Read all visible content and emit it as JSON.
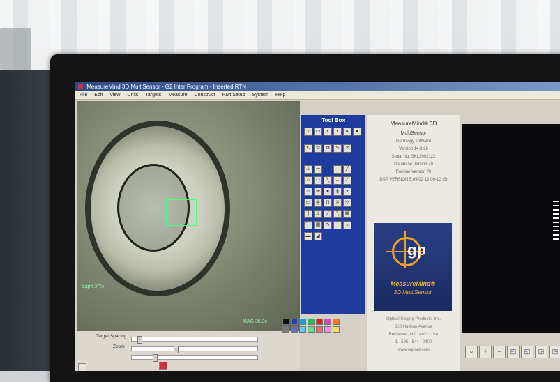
{
  "window": {
    "title": "MeasureMind 3D MultiSensor - G2 Inter Program - Inserted.RTN"
  },
  "menu": [
    "File",
    "Edit",
    "View",
    "Units",
    "Targets",
    "Measure",
    "Construct",
    "Part Setup",
    "System",
    "Help"
  ],
  "video": {
    "light_label": "Light 37%",
    "mag_label": "MAG 36.3x"
  },
  "controls": {
    "target_spacing_label": "Target Spacing",
    "zoom_label": "Zoom"
  },
  "toolbox": {
    "title": "Tool Box"
  },
  "palette_colors": [
    "#111111",
    "#2040c0",
    "#20a0e0",
    "#20c060",
    "#e02020",
    "#e040c0",
    "#e08020",
    "#777777",
    "#6070c0",
    "#60d0f0",
    "#60e090",
    "#f07070",
    "#f090e0",
    "#f0e060"
  ],
  "info": {
    "product": "MeasureMind® 3D",
    "product_sub": "MultiSensor",
    "tagline": "metrology software",
    "version": "Version 14.3.26",
    "serial": "Serial No.  SKL3002122",
    "db_version": "Database Version 70",
    "routine_version": "Routine Version 70",
    "dsp_version": "DSP VERSION 5.09.02 12-09-10 (3)",
    "logo_text": "gp",
    "logo_line1": "MeasureMind®",
    "logo_line2": "3D MultiSensor",
    "company": "Optical Gaging Products, Inc.",
    "street": "850 Hudson Avenue",
    "city": "Rochester, NY 14621 USA",
    "phone": "1 - 585 - 544 - 0400",
    "web": "www.ogpnet.com"
  }
}
